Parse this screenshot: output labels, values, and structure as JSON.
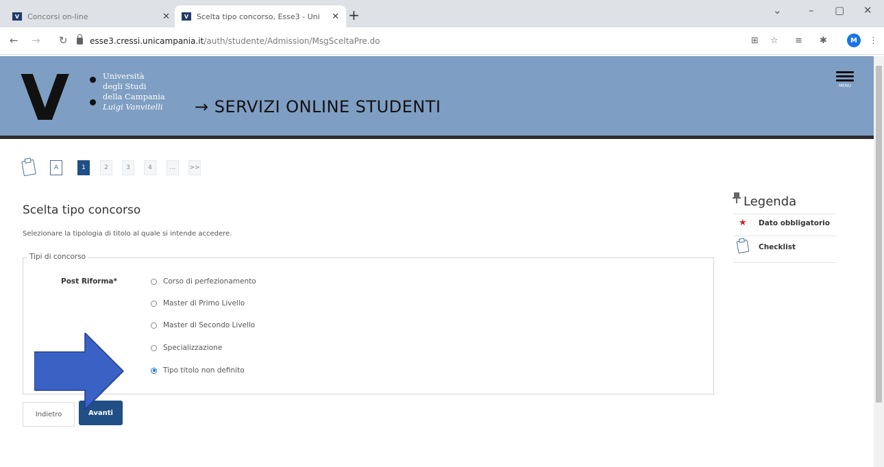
{
  "browser": {
    "tabs": [
      {
        "title": "Concorsi on-line",
        "active": false
      },
      {
        "title": "Scelta tipo concorso, Esse3 - Uni",
        "active": true
      }
    ],
    "new_tab_icon": "plus-icon",
    "url_domain": "esse3.cressi.unicampania.it",
    "url_path": "/auth/studente/Admission/MsgSceltaPre.do",
    "profile_initial": "M"
  },
  "header": {
    "logo_lines": [
      "Università",
      "degli Studi",
      "della Campania",
      "Luigi Vanvitelli"
    ],
    "title": "→ SERVIZI ONLINE STUDENTI",
    "menu_label": "MENU",
    "bg_color": "#7e9ec3"
  },
  "steps": [
    "A",
    "1",
    "2",
    "3",
    "4",
    "...",
    ">>"
  ],
  "active_step": "1",
  "main": {
    "title": "Scelta tipo concorso",
    "intro": "Selezionare la tipologia di titolo al quale si intende accedere.",
    "fieldset_legend": "Tipi di concorso",
    "field_label": "Post Riforma*",
    "options": [
      {
        "label": "Corso di perfezionamento",
        "checked": false
      },
      {
        "label": "Master di Primo Livello",
        "checked": false
      },
      {
        "label": "Master di Secondo Livello",
        "checked": false
      },
      {
        "label": "Specializzazione",
        "checked": false
      },
      {
        "label": "Tipo titolo non definito",
        "checked": true
      }
    ],
    "back_label": "Indietro",
    "next_label": "Avanti"
  },
  "legend": {
    "title": "Legenda",
    "items": [
      {
        "icon": "star-icon",
        "label": "Dato obbligatorio"
      },
      {
        "icon": "checklist-icon",
        "label": "Checklist"
      }
    ]
  },
  "colors": {
    "primary": "#1f4f85",
    "arrow": "#3a62c4",
    "required_star": "#cc2222"
  }
}
